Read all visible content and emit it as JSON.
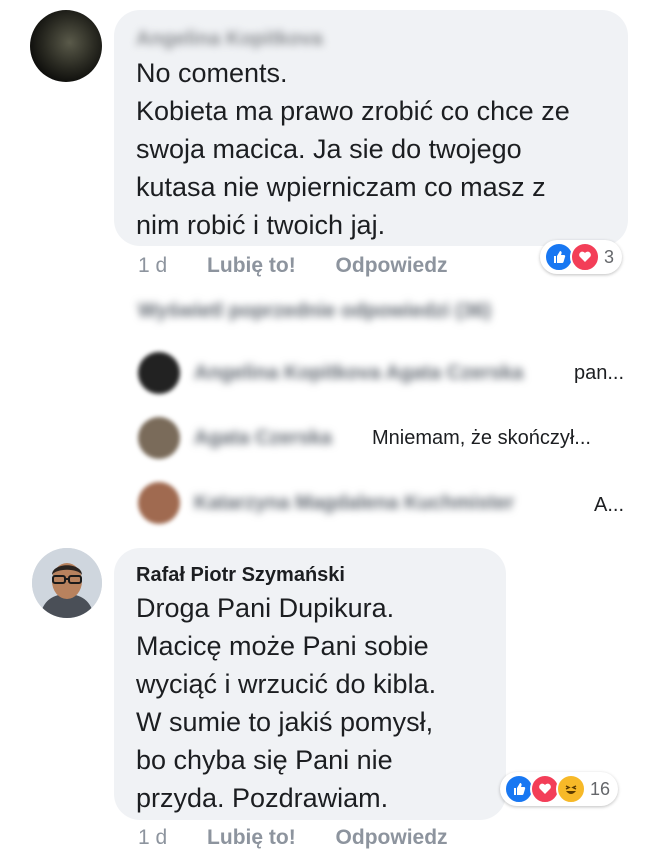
{
  "comments": [
    {
      "author": "Angelina Kopitkova",
      "lines": [
        "No coments.",
        "Kobieta ma prawo zrobić co chce ze",
        "swoja macica. Ja sie do twojego",
        "kutasa nie wpierniczam co masz z",
        "nim robić i twoich jaj."
      ],
      "time": "1 d",
      "like_label": "Lubię to!",
      "reply_label": "Odpowiedz",
      "reaction_count": "3"
    },
    {
      "author": "Rafał Piotr Szymański",
      "lines": [
        "Droga Pani Dupikura.",
        "Macicę może Pani sobie",
        "wyciąć i wrzucić do kibla.",
        "W sumie to jakiś pomysł,",
        "bo chyba się Pani nie",
        "przyda. Pozdrawiam."
      ],
      "time": "1 d",
      "like_label": "Lubię to!",
      "reply_label": "Odpowiedz",
      "reaction_count": "16"
    }
  ],
  "previous_replies_label": "Wyświetl poprzednie odpowiedzi (36)",
  "replies": [
    {
      "author": "Angelina Kopitkova Agata Czerska",
      "snippet": "pan..."
    },
    {
      "author": "Agata Czerska",
      "snippet": "Mniemam, że skończył..."
    },
    {
      "author": "Katarzyna Magdalena Kuchmister",
      "snippet": "A..."
    }
  ]
}
